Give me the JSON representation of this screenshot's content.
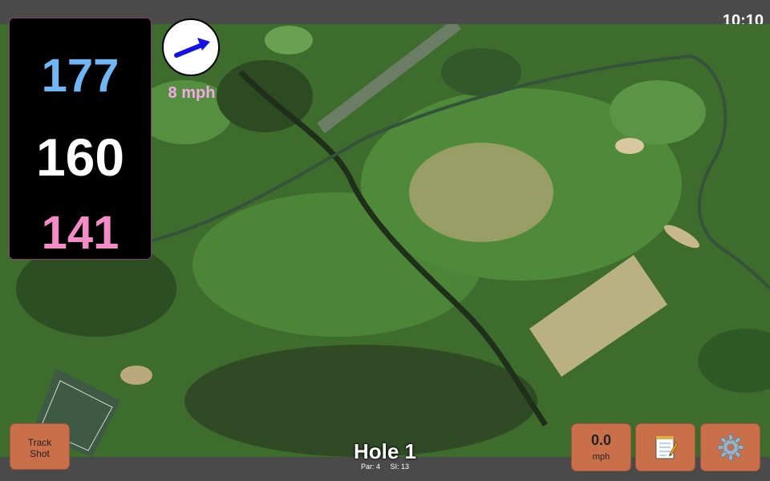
{
  "status_bar": {
    "time": "10:10"
  },
  "distances": {
    "back": "177",
    "middle": "160",
    "front": "141",
    "back_color": "#6fb6f2",
    "middle_color": "#ffffff",
    "front_color": "#f28bc6"
  },
  "wind": {
    "speed_label": "8 mph",
    "direction_icon": "wind-arrow-icon",
    "arrow_color": "#1212e6",
    "label_color": "#f5a9e6"
  },
  "buttons": {
    "track_shot_line1": "Track",
    "track_shot_line2": "Shot",
    "speed_value": "0.0",
    "speed_unit": "mph",
    "notes_icon": "notepad-icon",
    "settings_icon": "gear-icon"
  },
  "hole": {
    "title": "Hole 1",
    "par": "Par: 4",
    "si": "SI: 13"
  },
  "colors": {
    "button_bg": "#c9704a",
    "bar_bg": "#4a4a4a"
  }
}
